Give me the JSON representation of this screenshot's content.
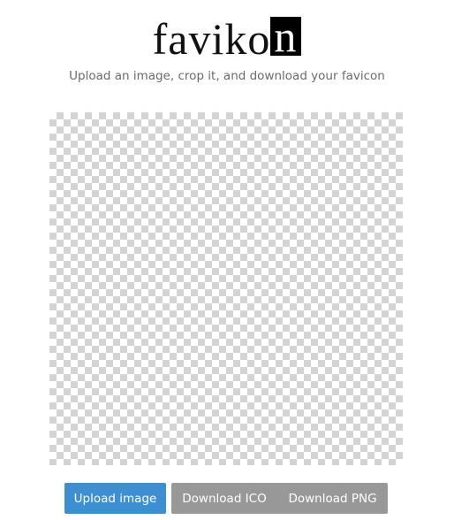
{
  "logo": {
    "text_plain": "faviko",
    "text_inverse": "n"
  },
  "tagline": "Upload an image, crop it, and download your favicon",
  "canvas": {
    "pattern": "transparency-checkerboard",
    "colors": {
      "light": "#ffffff",
      "dark": "#d3d3d3"
    }
  },
  "buttons": {
    "upload_label": "Upload image",
    "download_ico_label": "Download ICO",
    "download_png_label": "Download PNG"
  },
  "colors": {
    "primary_button": "#3d8fd1",
    "secondary_button": "#989898",
    "tagline_text": "#6a6a6a"
  }
}
